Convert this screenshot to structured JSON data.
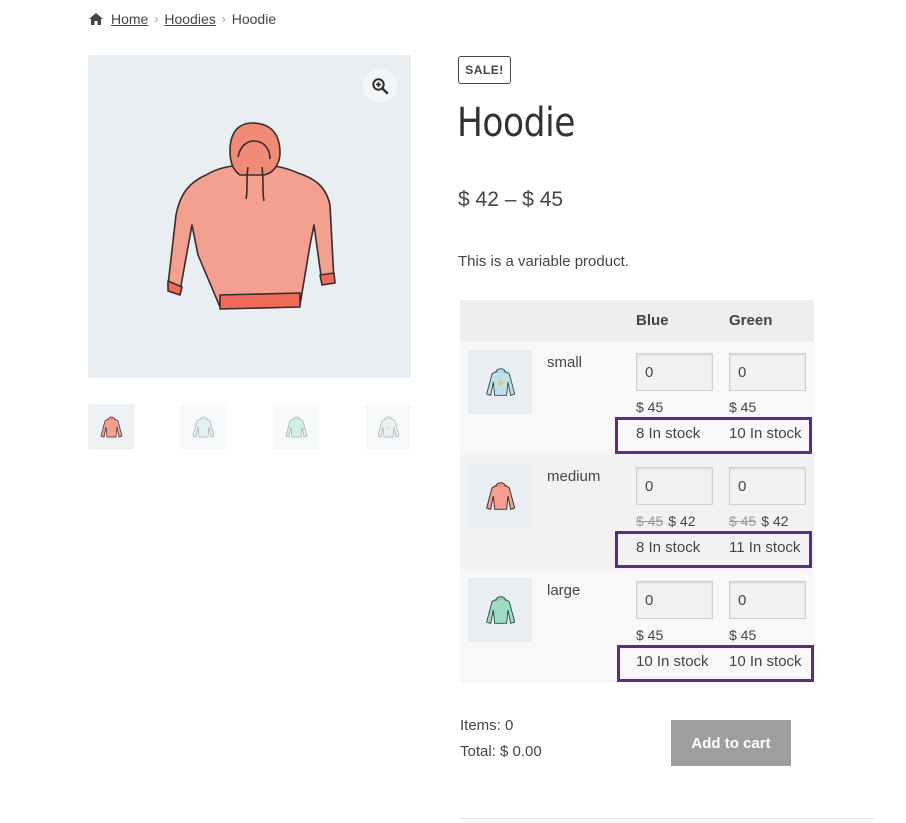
{
  "breadcrumb": {
    "icon": "home-icon",
    "items": [
      "Home",
      "Hoodies",
      "Hoodie"
    ]
  },
  "gallery": {
    "zoom_icon": "magnifier-plus-icon",
    "thumbnails": [
      "hoodie-red",
      "hoodie-blue",
      "hoodie-green",
      "hoodie-blue-logo"
    ]
  },
  "product": {
    "badge": "SALE!",
    "title": "Hoodie",
    "price_range": "$ 42 – $ 45",
    "short_description": "This is a variable product."
  },
  "variations_table": {
    "columns": [
      "Blue",
      "Green"
    ],
    "rows": [
      {
        "size": "small",
        "image": "hoodie-blue",
        "cells": [
          {
            "qty": "0",
            "regular_price": "",
            "price": "$ 45",
            "stock": "8 In stock"
          },
          {
            "qty": "0",
            "regular_price": "",
            "price": "$ 45",
            "stock": "10 In stock"
          }
        ]
      },
      {
        "size": "medium",
        "image": "hoodie-red",
        "cells": [
          {
            "qty": "0",
            "regular_price": "$ 45",
            "price": "$ 42",
            "stock": "8 In stock"
          },
          {
            "qty": "0",
            "regular_price": "$ 45",
            "price": "$ 42",
            "stock": "11 In stock"
          }
        ]
      },
      {
        "size": "large",
        "image": "hoodie-green",
        "cells": [
          {
            "qty": "0",
            "regular_price": "",
            "price": "$ 45",
            "stock": "10 In stock"
          },
          {
            "qty": "0",
            "regular_price": "",
            "price": "$ 45",
            "stock": "10 In stock"
          }
        ]
      }
    ]
  },
  "cart": {
    "items_label": "Items: 0",
    "total_label": "Total: $ 0.00",
    "add_to_cart": "Add to cart"
  },
  "colors": {
    "highlight_border": "#5b2c83",
    "button_disabled": "#9e9e9e",
    "image_background": "#e9eef3"
  }
}
